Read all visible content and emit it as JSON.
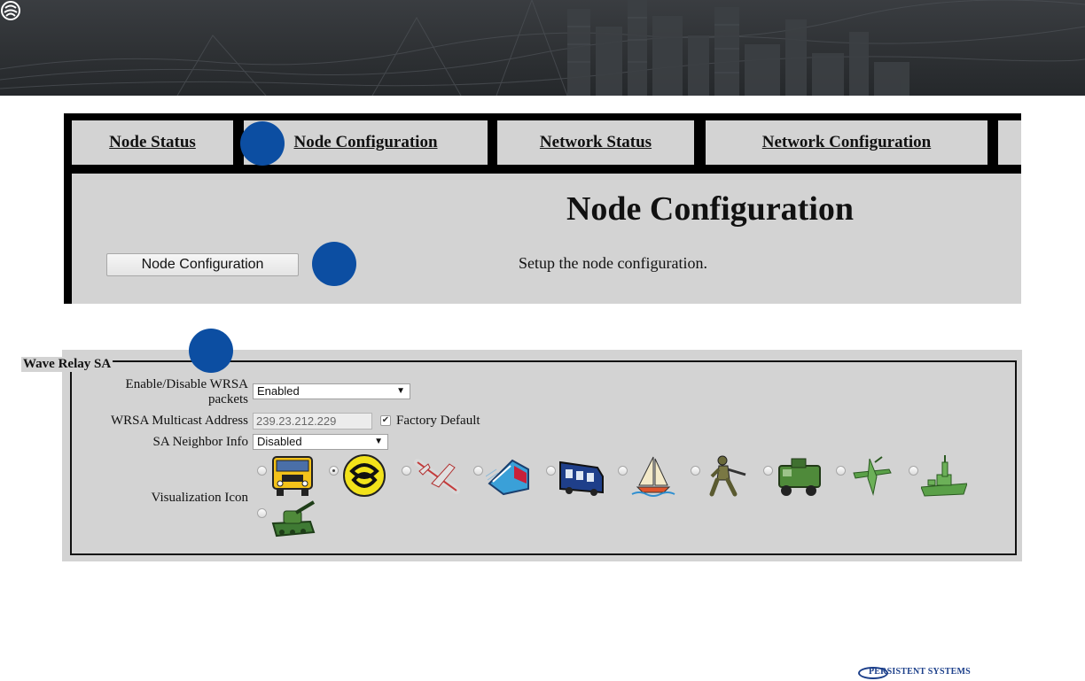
{
  "header": {
    "logo_icon": "persistent-logo-icon"
  },
  "nav": {
    "tabs": [
      {
        "label": "Node Status"
      },
      {
        "label": "Node Configuration"
      },
      {
        "label": "Network Status"
      },
      {
        "label": "Network Configuration"
      },
      {
        "label": ""
      }
    ]
  },
  "main": {
    "title": "Node Configuration",
    "config_button_label": "Node Configuration",
    "config_description": "Setup the node configuration."
  },
  "wrsa": {
    "legend": "Wave Relay SA",
    "enable_label": "Enable/Disable WRSA packets",
    "enable_value": "Enabled",
    "multicast_label": "WRSA Multicast Address",
    "multicast_value": "239.23.212.229",
    "factory_default_label": "Factory Default",
    "factory_default_checked": true,
    "neighbor_label": "SA Neighbor Info",
    "neighbor_value": "Disabled",
    "visualization_label": "Visualization Icon",
    "icons": [
      {
        "name": "school-bus-icon",
        "selected": false
      },
      {
        "name": "persistent-knot-icon",
        "selected": true
      },
      {
        "name": "airplane-icon",
        "selected": false
      },
      {
        "name": "train-icon",
        "selected": false
      },
      {
        "name": "bus-icon",
        "selected": false
      },
      {
        "name": "sailboat-icon",
        "selected": false
      },
      {
        "name": "soldier-icon",
        "selected": false
      },
      {
        "name": "humvee-icon",
        "selected": false
      },
      {
        "name": "drone-icon",
        "selected": false
      },
      {
        "name": "warship-icon",
        "selected": false
      },
      {
        "name": "tank-icon",
        "selected": false
      }
    ]
  },
  "colors": {
    "marker": "#0c4ea2",
    "panel_gray": "#d3d3d3",
    "banner": "#2e3134"
  },
  "footer": {
    "brand": "PERSISTENT SYSTEMS"
  }
}
